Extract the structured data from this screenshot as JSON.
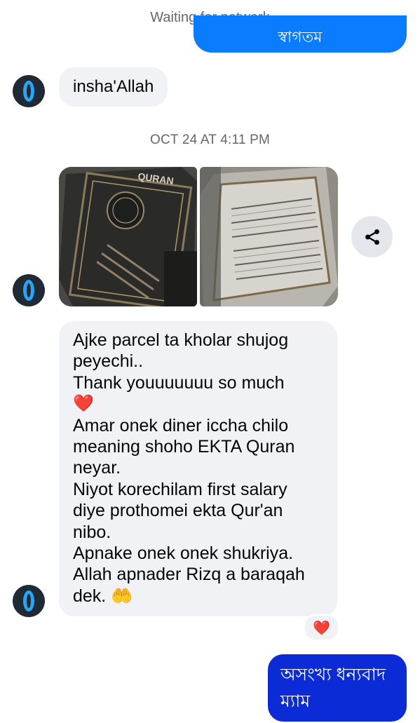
{
  "status_bar": {
    "text": "Waiting for network"
  },
  "messages": {
    "top_outgoing_partial": "স্বাগতম",
    "incoming_short": "insha'Allah",
    "timestamp": "OCT 24 AT 4:11 PM",
    "incoming_long": {
      "lines": [
        "Ajke parcel ta kholar shujog",
        "peyechi..",
        "Thank youuuuuuu so much",
        "❤️",
        "Amar onek diner iccha chilo",
        "meaning shoho EKTA Quran",
        "neyar.",
        "Niyot korechilam first salary",
        "diye prothomei ekta Qur'an",
        "nibo.",
        "Apnake onek onek shukriya.",
        "Allah apnader Rizq a baraqah",
        "dek. 🤲"
      ]
    },
    "reaction": "❤️",
    "outgoing_last": {
      "lines": [
        "অসংখ্য ধন্যবাদ",
        "ম্যাম"
      ]
    }
  },
  "icons": {
    "share": "share-icon",
    "avatar": "contact-avatar"
  },
  "colors": {
    "outgoing_bubble": "#0a7cff",
    "outgoing_bubble_last": "#0a2bd6",
    "incoming_bubble": "#f0f2f5",
    "muted_text": "#65676b",
    "heart": "#e0242f"
  }
}
